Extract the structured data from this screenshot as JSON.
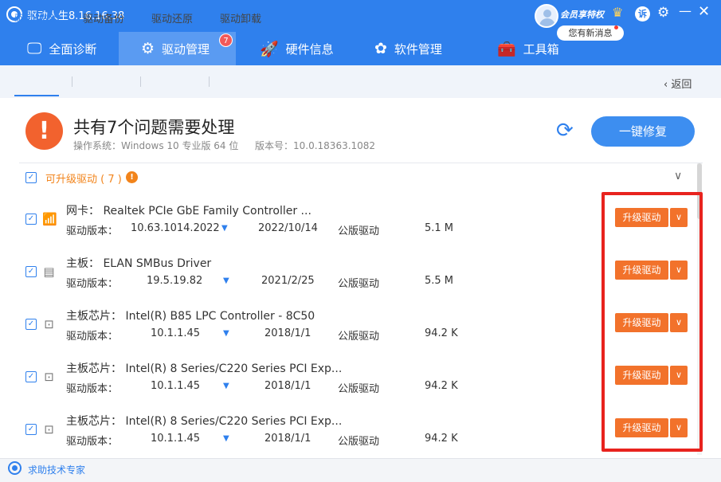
{
  "window": {
    "title": "驱动人生8.16.16.38"
  },
  "account": {
    "vip_label": "会员享特权",
    "message": "您有新消息",
    "complain_icon": "诉"
  },
  "nav": {
    "tabs": [
      {
        "label": "全面诊断",
        "icon": "monitor-icon"
      },
      {
        "label": "驱动管理",
        "icon": "gear-icon",
        "badge": "7"
      },
      {
        "label": "硬件信息",
        "icon": "rocket-icon"
      },
      {
        "label": "软件管理",
        "icon": "flower-icon"
      },
      {
        "label": "工具箱",
        "icon": "toolbox-icon"
      }
    ]
  },
  "subnav": {
    "tabs": [
      "驱动体检",
      "驱动备份",
      "驱动还原",
      "驱动卸载"
    ],
    "back": "返回"
  },
  "summary": {
    "title": "共有7个问题需要处理",
    "os": "操作系统：Windows 10 专业版 64 位",
    "version": "版本号：10.0.18363.1082",
    "fix_button": "一键修复"
  },
  "section": {
    "label": "可升级驱动 ( 7 )"
  },
  "drivers": [
    {
      "name": "网卡： Realtek PCIe GbE Family Controller ...",
      "ver_label": "驱动版本：",
      "version": "10.63.1014.2022",
      "date": "2022/10/14",
      "type": "公版驱动",
      "size": "5.1 M",
      "button": "升级驱动",
      "icon": "network-icon"
    },
    {
      "name": "主板： ELAN SMBus Driver",
      "ver_label": "驱动版本：",
      "version": "19.5.19.82",
      "date": "2021/2/25",
      "type": "公版驱动",
      "size": "5.5 M",
      "button": "升级驱动",
      "icon": "motherboard-icon"
    },
    {
      "name": "主板芯片： Intel(R) B85 LPC Controller - 8C50",
      "ver_label": "驱动版本：",
      "version": "10.1.1.45",
      "date": "2018/1/1",
      "type": "公版驱动",
      "size": "94.2 K",
      "button": "升级驱动",
      "icon": "chip-icon"
    },
    {
      "name": "主板芯片： Intel(R) 8 Series/C220 Series PCI Exp...",
      "ver_label": "驱动版本：",
      "version": "10.1.1.45",
      "date": "2018/1/1",
      "type": "公版驱动",
      "size": "94.2 K",
      "button": "升级驱动",
      "icon": "chip-icon"
    },
    {
      "name": "主板芯片： Intel(R) 8 Series/C220 Series PCI Exp...",
      "ver_label": "驱动版本：",
      "version": "10.1.1.45",
      "date": "2018/1/1",
      "type": "公版驱动",
      "size": "94.2 K",
      "button": "升级驱动",
      "icon": "chip-icon"
    }
  ],
  "footer": {
    "help": "求助技术专家"
  },
  "colors": {
    "brand": "#2f80ed",
    "accent": "#f2722b",
    "warning": "#f2622e",
    "highlight": "#e8231e"
  }
}
